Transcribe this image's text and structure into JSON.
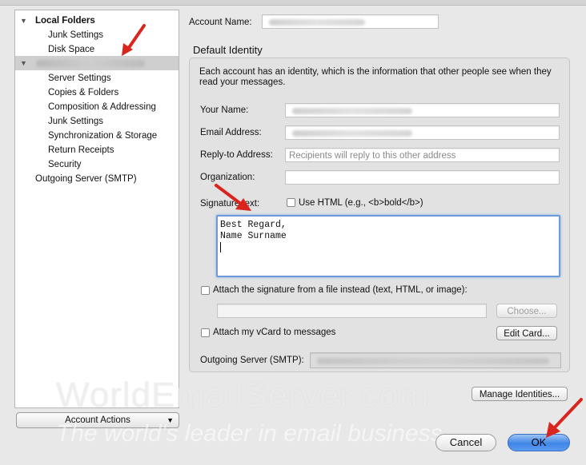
{
  "sidebar": {
    "items": [
      {
        "label": "Local Folders",
        "level": 0,
        "expanded": true
      },
      {
        "label": "Junk Settings",
        "level": 1
      },
      {
        "label": "Disk Space",
        "level": 1
      },
      {
        "label": "",
        "level": 0,
        "expanded": true,
        "selected": true,
        "redacted": true
      },
      {
        "label": "Server Settings",
        "level": 1
      },
      {
        "label": "Copies & Folders",
        "level": 1
      },
      {
        "label": "Composition & Addressing",
        "level": 1
      },
      {
        "label": "Junk Settings",
        "level": 1
      },
      {
        "label": "Synchronization & Storage",
        "level": 1
      },
      {
        "label": "Return Receipts",
        "level": 1
      },
      {
        "label": "Security",
        "level": 1
      },
      {
        "label": "Outgoing Server (SMTP)",
        "level": 0
      }
    ],
    "account_actions_label": "Account Actions"
  },
  "account": {
    "name_label": "Account Name:"
  },
  "identity": {
    "section_title": "Default Identity",
    "description": "Each account has an identity, which is the information that other people see when they read your messages.",
    "your_name_label": "Your Name:",
    "email_label": "Email Address:",
    "reply_to_label": "Reply-to Address:",
    "reply_to_placeholder": "Recipients will reply to this other address",
    "organization_label": "Organization:",
    "signature_label": "Signature text:",
    "use_html_label": "Use HTML (e.g., <b>bold</b>)",
    "use_html_checked": false,
    "signature_lines": [
      "Best Regard,",
      "Name Surname"
    ],
    "attach_file_label": "Attach the signature from a file instead (text, HTML, or image):",
    "attach_file_checked": false,
    "choose_label": "Choose...",
    "attach_vcard_label": "Attach my vCard to messages",
    "attach_vcard_checked": false,
    "edit_card_label": "Edit Card...",
    "outgoing_label": "Outgoing Server (SMTP):"
  },
  "buttons": {
    "manage_identities": "Manage Identities...",
    "cancel": "Cancel",
    "ok": "OK"
  },
  "watermark": {
    "line1": "WorldEmailServer.com",
    "line2": "The world's leader in email business"
  },
  "colors": {
    "annotation_arrow": "#d9251d",
    "focus_ring": "#6d9ad6",
    "primary_button": "#3f86e6"
  },
  "icons": [
    "disclosure-triangle-icon",
    "dropdown-caret-icon",
    "annotation-arrow-icon"
  ]
}
